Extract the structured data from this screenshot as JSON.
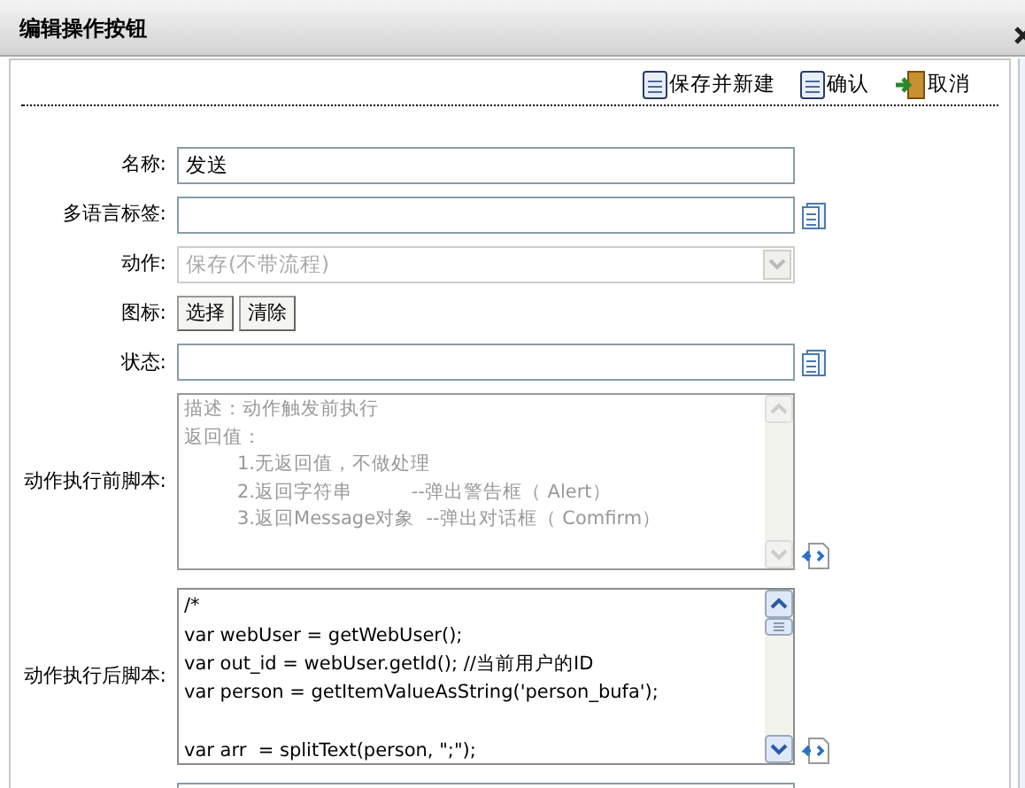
{
  "window": {
    "title": "编辑操作按钮"
  },
  "toolbar": [
    {
      "kind": "save",
      "label": "保存并新建"
    },
    {
      "kind": "save",
      "label": "确认"
    },
    {
      "kind": "exit",
      "label": "取消"
    }
  ],
  "fields": [
    {
      "kind": "text",
      "label": "名称:",
      "value": "发送"
    },
    {
      "kind": "text-icon",
      "label": "多语言标签:"
    },
    {
      "kind": "select",
      "label": "动作:",
      "value": "保存(不带流程)",
      "disabled": true
    },
    {
      "kind": "buttons",
      "label": "图标:",
      "buttons": [
        "选择",
        "清除"
      ]
    },
    {
      "kind": "text-icon",
      "label": "状态:"
    },
    {
      "kind": "script",
      "label": "动作执行前脚本:",
      "disabled": true,
      "lines": [
        {
          "kind": "line",
          "text": "描述：动作触发前执行"
        },
        {
          "kind": "line",
          "text": "返回值："
        },
        {
          "kind": "item",
          "text": "1.无返回值，不做处理"
        },
        {
          "kind": "item",
          "text": "2.返回字符串          --弹出警告框（ Alert）"
        },
        {
          "kind": "item",
          "text": "3.返回Message对象  --弹出对话框（ Comfirm）"
        }
      ]
    },
    {
      "kind": "script",
      "label": "动作执行后脚本:",
      "disabled": false,
      "lines": [
        {
          "kind": "line",
          "text": "/*"
        },
        {
          "kind": "line",
          "text": "var webUser = getWebUser();"
        },
        {
          "kind": "line",
          "text": "var out_id = webUser.getId(); //当前用户的ID"
        },
        {
          "kind": "line",
          "text": "var person = getItemValueAsString('person_bufa');"
        },
        {
          "kind": "blank"
        },
        {
          "kind": "line",
          "text": "var arr  = splitText(person, \";\");"
        }
      ]
    },
    {
      "kind": "partial"
    }
  ]
}
